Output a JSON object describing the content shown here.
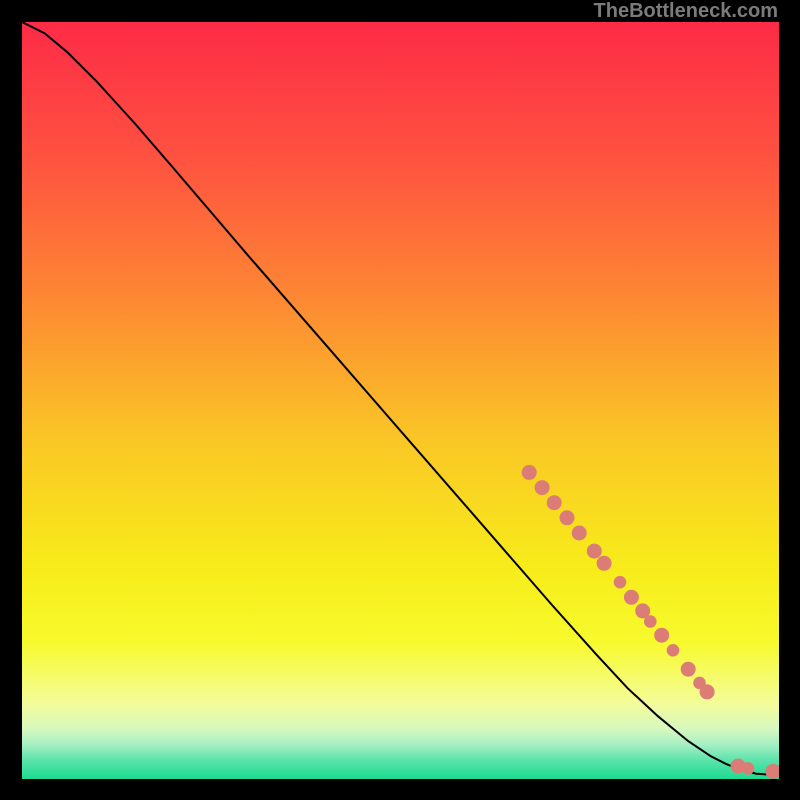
{
  "watermark": "TheBottleneck.com",
  "colors": {
    "frame": "#000000",
    "panel_black": "#000000",
    "marker": "#db7d76",
    "curve": "#000000"
  },
  "chart_data": {
    "type": "line",
    "title": "",
    "xlabel": "",
    "ylabel": "",
    "xlim": [
      0,
      100
    ],
    "ylim": [
      0,
      100
    ],
    "background_gradient": {
      "direction": "vertical",
      "stops": [
        {
          "pos": 0.0,
          "color": "#fd2b47"
        },
        {
          "pos": 0.18,
          "color": "#fe5240"
        },
        {
          "pos": 0.36,
          "color": "#fd8634"
        },
        {
          "pos": 0.55,
          "color": "#fac626"
        },
        {
          "pos": 0.72,
          "color": "#f7ec1a"
        },
        {
          "pos": 0.82,
          "color": "#f7fa2d"
        },
        {
          "pos": 0.9,
          "color": "#f4fc9a"
        },
        {
          "pos": 0.935,
          "color": "#d5f8c0"
        },
        {
          "pos": 0.955,
          "color": "#a4efc2"
        },
        {
          "pos": 0.975,
          "color": "#5de3ac"
        },
        {
          "pos": 1.0,
          "color": "#1cdb92"
        }
      ]
    },
    "series": [
      {
        "name": "curve",
        "x": [
          0,
          3,
          6,
          10,
          15,
          20,
          30,
          40,
          50,
          60,
          70,
          76,
          80,
          84,
          88,
          91,
          93,
          95,
          97,
          100
        ],
        "y": [
          100,
          98.5,
          96,
          92,
          86.5,
          80.7,
          69,
          57.5,
          46,
          34.5,
          23,
          16.3,
          12,
          8.3,
          5,
          3,
          2,
          1.2,
          0.7,
          0.5
        ]
      }
    ],
    "markers": [
      {
        "x": 67.0,
        "y": 40.5,
        "r": 6
      },
      {
        "x": 68.7,
        "y": 38.5,
        "r": 6
      },
      {
        "x": 70.3,
        "y": 36.5,
        "r": 6
      },
      {
        "x": 72.0,
        "y": 34.5,
        "r": 6
      },
      {
        "x": 73.6,
        "y": 32.5,
        "r": 6
      },
      {
        "x": 75.6,
        "y": 30.1,
        "r": 6
      },
      {
        "x": 76.9,
        "y": 28.5,
        "r": 6
      },
      {
        "x": 79.0,
        "y": 26.0,
        "r": 5
      },
      {
        "x": 80.5,
        "y": 24.0,
        "r": 6
      },
      {
        "x": 82.0,
        "y": 22.2,
        "r": 6
      },
      {
        "x": 83.0,
        "y": 20.8,
        "r": 5
      },
      {
        "x": 84.5,
        "y": 19.0,
        "r": 6
      },
      {
        "x": 86.0,
        "y": 17.0,
        "r": 5
      },
      {
        "x": 88.0,
        "y": 14.5,
        "r": 6
      },
      {
        "x": 89.5,
        "y": 12.7,
        "r": 5
      },
      {
        "x": 90.5,
        "y": 11.5,
        "r": 6
      },
      {
        "x": 94.6,
        "y": 1.7,
        "r": 6
      },
      {
        "x": 95.9,
        "y": 1.4,
        "r": 5
      },
      {
        "x": 99.2,
        "y": 1.0,
        "r": 6
      },
      {
        "x": 100.0,
        "y": 1.0,
        "r": 5
      }
    ]
  }
}
